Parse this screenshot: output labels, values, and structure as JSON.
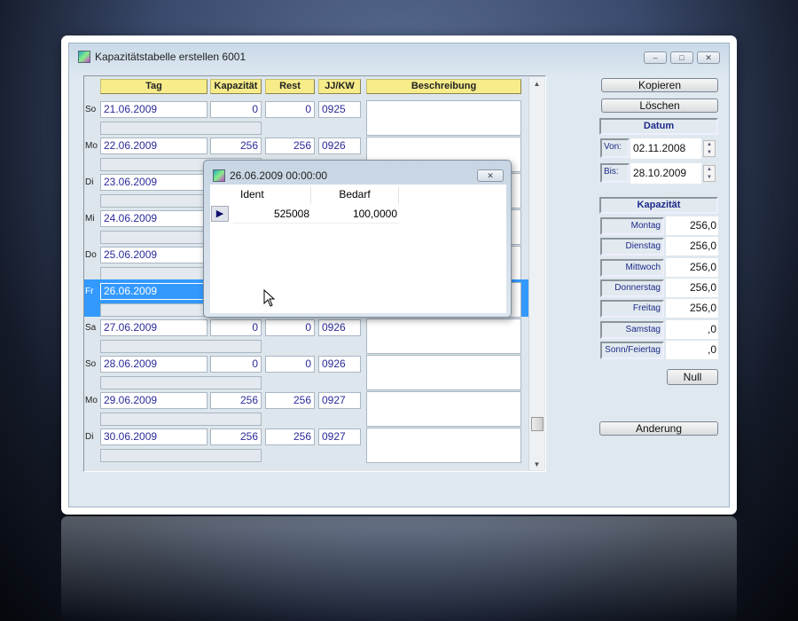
{
  "window": {
    "title": "Kapazitätstabelle erstellen 6001",
    "minimize": "–",
    "maximize": "□",
    "close": "✕"
  },
  "table": {
    "headers": {
      "tag": "Tag",
      "kapazitaet": "Kapazität",
      "rest": "Rest",
      "kw": "JJ/KW",
      "beschreibung": "Beschreibung"
    },
    "rows": [
      {
        "day": "So",
        "date": "21.06.2009",
        "kap": "0",
        "rest": "0",
        "kw": "0925"
      },
      {
        "day": "Mo",
        "date": "22.06.2009",
        "kap": "256",
        "rest": "256",
        "kw": "0926"
      },
      {
        "day": "Di",
        "date": "23.06.2009",
        "kap": "",
        "rest": "",
        "kw": ""
      },
      {
        "day": "Mi",
        "date": "24.06.2009",
        "kap": "",
        "rest": "",
        "kw": ""
      },
      {
        "day": "Do",
        "date": "25.06.2009",
        "kap": "",
        "rest": "",
        "kw": ""
      },
      {
        "day": "Fr",
        "date": "26.06.2009",
        "kap": "",
        "rest": "",
        "kw": "",
        "selected": true
      },
      {
        "day": "Sa",
        "date": "27.06.2009",
        "kap": "0",
        "rest": "0",
        "kw": "0926"
      },
      {
        "day": "So",
        "date": "28.06.2009",
        "kap": "0",
        "rest": "0",
        "kw": "0926"
      },
      {
        "day": "Mo",
        "date": "29.06.2009",
        "kap": "256",
        "rest": "256",
        "kw": "0927"
      },
      {
        "day": "Di",
        "date": "30.06.2009",
        "kap": "256",
        "rest": "256",
        "kw": "0927"
      }
    ]
  },
  "popup": {
    "title": "26.06.2009 00:00:00",
    "close": "✕",
    "columns": [
      "Ident",
      "Bedarf"
    ],
    "rows": [
      {
        "ident": "525008",
        "bedarf": "100,0000"
      }
    ]
  },
  "panel": {
    "kopieren": "Kopieren",
    "loeschen": "Löschen",
    "datum": {
      "header": "Datum",
      "von_label": "Von:",
      "von": "02.11.2008",
      "bis_label": "Bis:",
      "bis": "28.10.2009"
    },
    "kapazitaet": {
      "header": "Kapazität",
      "items": [
        {
          "label": "Montag",
          "value": "256,0"
        },
        {
          "label": "Dienstag",
          "value": "256,0"
        },
        {
          "label": "Mittwoch",
          "value": "256,0"
        },
        {
          "label": "Donnerstag",
          "value": "256,0"
        },
        {
          "label": "Freitag",
          "value": "256,0"
        },
        {
          "label": "Samstag",
          "value": ",0"
        },
        {
          "label": "Sonn/Feiertag",
          "value": ",0"
        }
      ]
    },
    "null": "Null",
    "anderung": "Anderung"
  },
  "colors": {
    "selected": "#3399ff",
    "header": "#f7ec8a",
    "text": "#2a2a9a"
  }
}
